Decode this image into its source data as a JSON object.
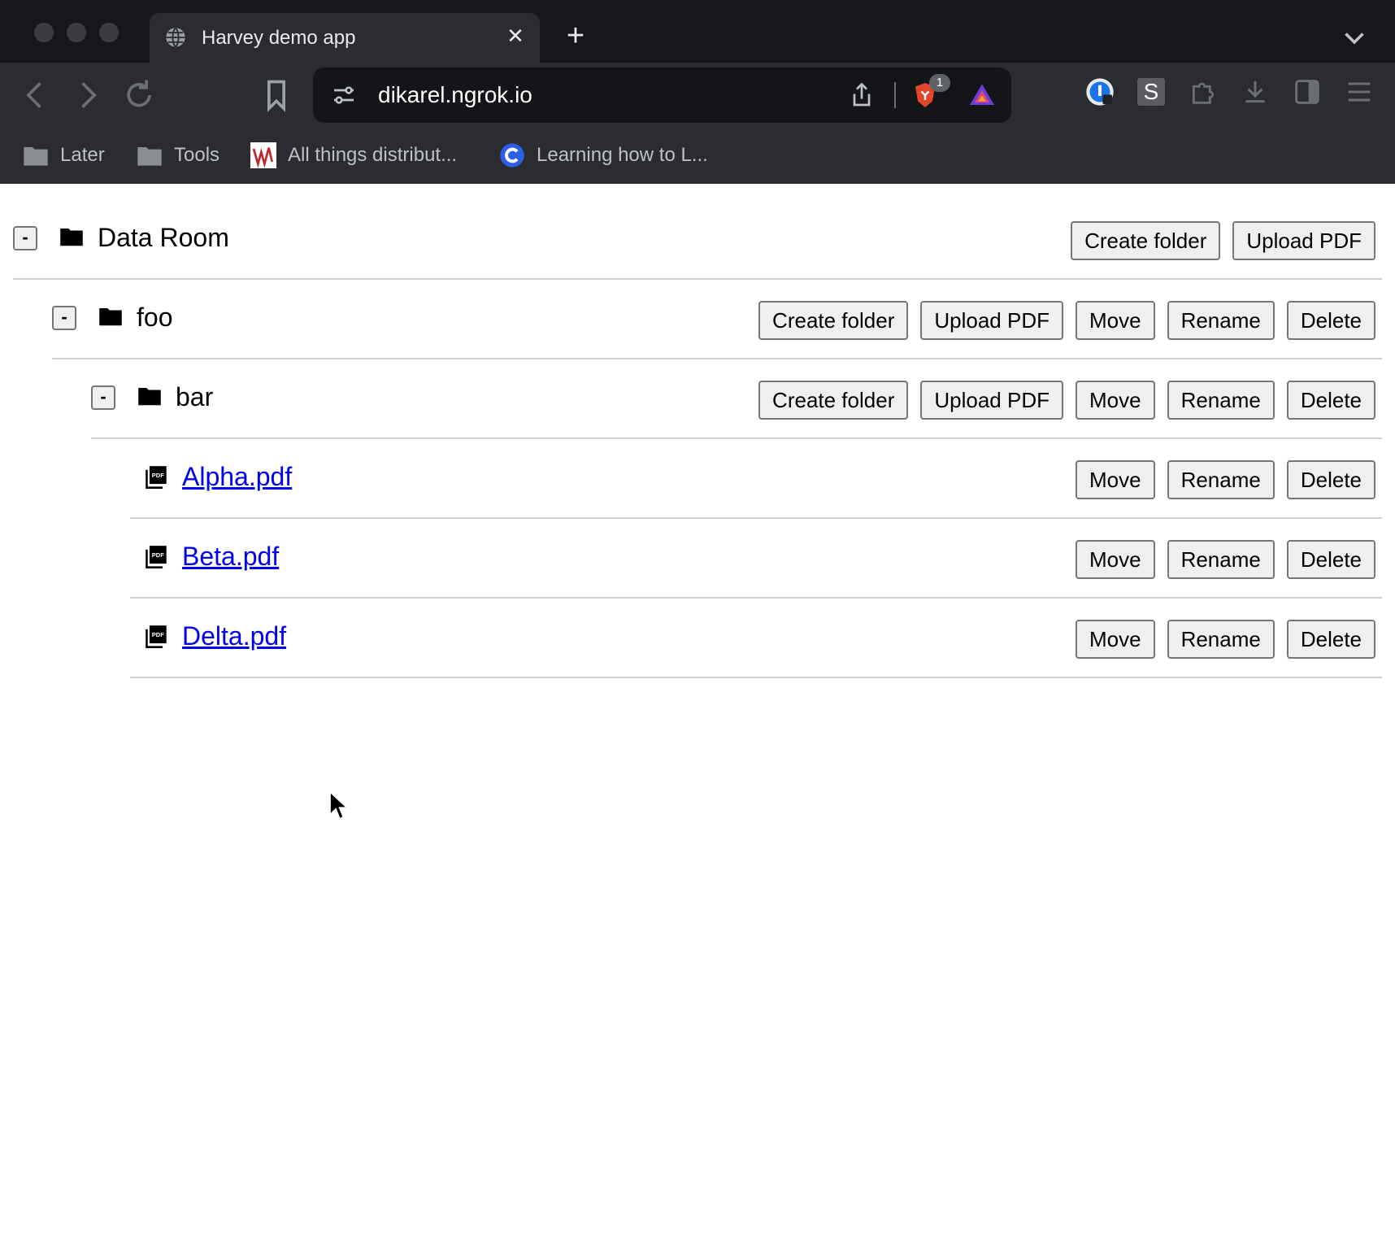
{
  "browser": {
    "tab_title": "Harvey demo app",
    "tab_close_glyph": "✕",
    "new_tab_glyph": "+",
    "url": "dikarel.ngrok.io",
    "shields_badge_count": "1",
    "extension_s_label": "S",
    "bookmarks": [
      {
        "label": "Later",
        "icon": "folder-icon"
      },
      {
        "label": "Tools",
        "icon": "folder-icon"
      },
      {
        "label": "All things distribut...",
        "icon": "site-favicon"
      },
      {
        "label": "Learning how to L...",
        "icon": "site-favicon-c"
      }
    ]
  },
  "tree": {
    "toggle_label": "-",
    "buttons": {
      "create_folder": "Create folder",
      "upload_pdf": "Upload PDF",
      "move": "Move",
      "rename": "Rename",
      "delete": "Delete"
    },
    "rows": [
      {
        "type": "folder",
        "name": "Data Room",
        "depth": 0
      },
      {
        "type": "folder",
        "name": "foo",
        "depth": 1
      },
      {
        "type": "folder",
        "name": "bar",
        "depth": 2
      },
      {
        "type": "file",
        "name": "Alpha.pdf",
        "depth": 3
      },
      {
        "type": "file",
        "name": "Beta.pdf",
        "depth": 3
      },
      {
        "type": "file",
        "name": "Delta.pdf",
        "depth": 3
      }
    ]
  },
  "colors": {
    "chrome_bg": "#202124",
    "link": "#0000ee",
    "button_bg": "#efefef",
    "divider": "#cfcfcf"
  }
}
